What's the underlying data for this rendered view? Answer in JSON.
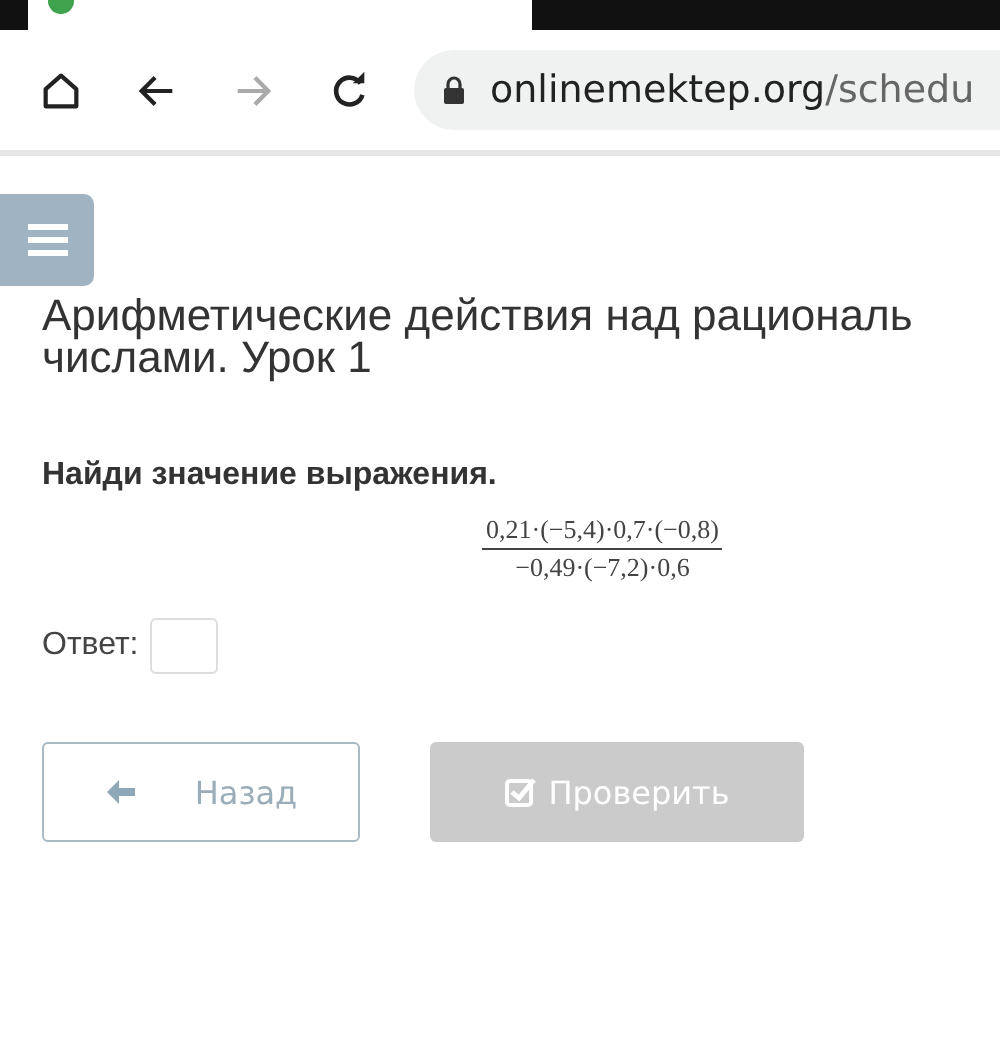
{
  "browser": {
    "address": {
      "host": "onlinemektep.org",
      "path": "/schedu"
    }
  },
  "page": {
    "title_lines": [
      "Арифметические действия над рациональ",
      "числами. Урок 1"
    ],
    "question": "Найди значение выражения.",
    "expression": {
      "numerator": "0,21·(−5,4)·0,7·(−0,8)",
      "denominator": "−0,49·(−7,2)·0,6"
    },
    "answer": {
      "label": "Ответ:"
    },
    "buttons": [
      {
        "kind": "back",
        "label": "Назад",
        "disabled": false
      },
      {
        "kind": "check",
        "label": "Проверить",
        "disabled": true
      }
    ]
  }
}
